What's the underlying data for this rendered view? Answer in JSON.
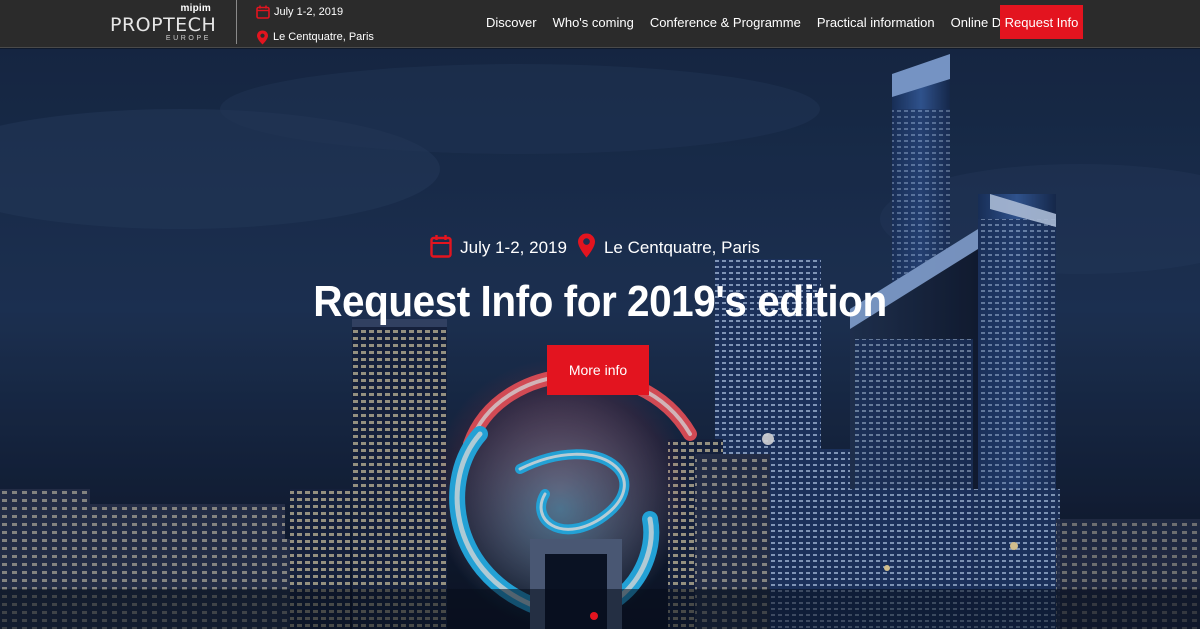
{
  "brand": {
    "top": "mipim",
    "main": "PROPTECH",
    "sub": "EUROPE"
  },
  "event": {
    "date": "July 1-2, 2019",
    "location": "Le Centquatre, Paris"
  },
  "nav": {
    "items": [
      {
        "label": "Discover"
      },
      {
        "label": "Who's coming"
      },
      {
        "label": "Conference & Programme"
      },
      {
        "label": "Practical information"
      },
      {
        "label": "Online Database"
      }
    ],
    "cta": "Request Info"
  },
  "hero": {
    "date": "July 1-2, 2019",
    "location": "Le Centquatre, Paris",
    "title": "Request Info for 2019's edition",
    "button": "More info"
  },
  "icons": {
    "date": "calendar-icon",
    "location": "map-pin-icon"
  },
  "colors": {
    "accent": "#e3141f",
    "topbar": "#2b2b2b",
    "sky": "#1f3456"
  }
}
